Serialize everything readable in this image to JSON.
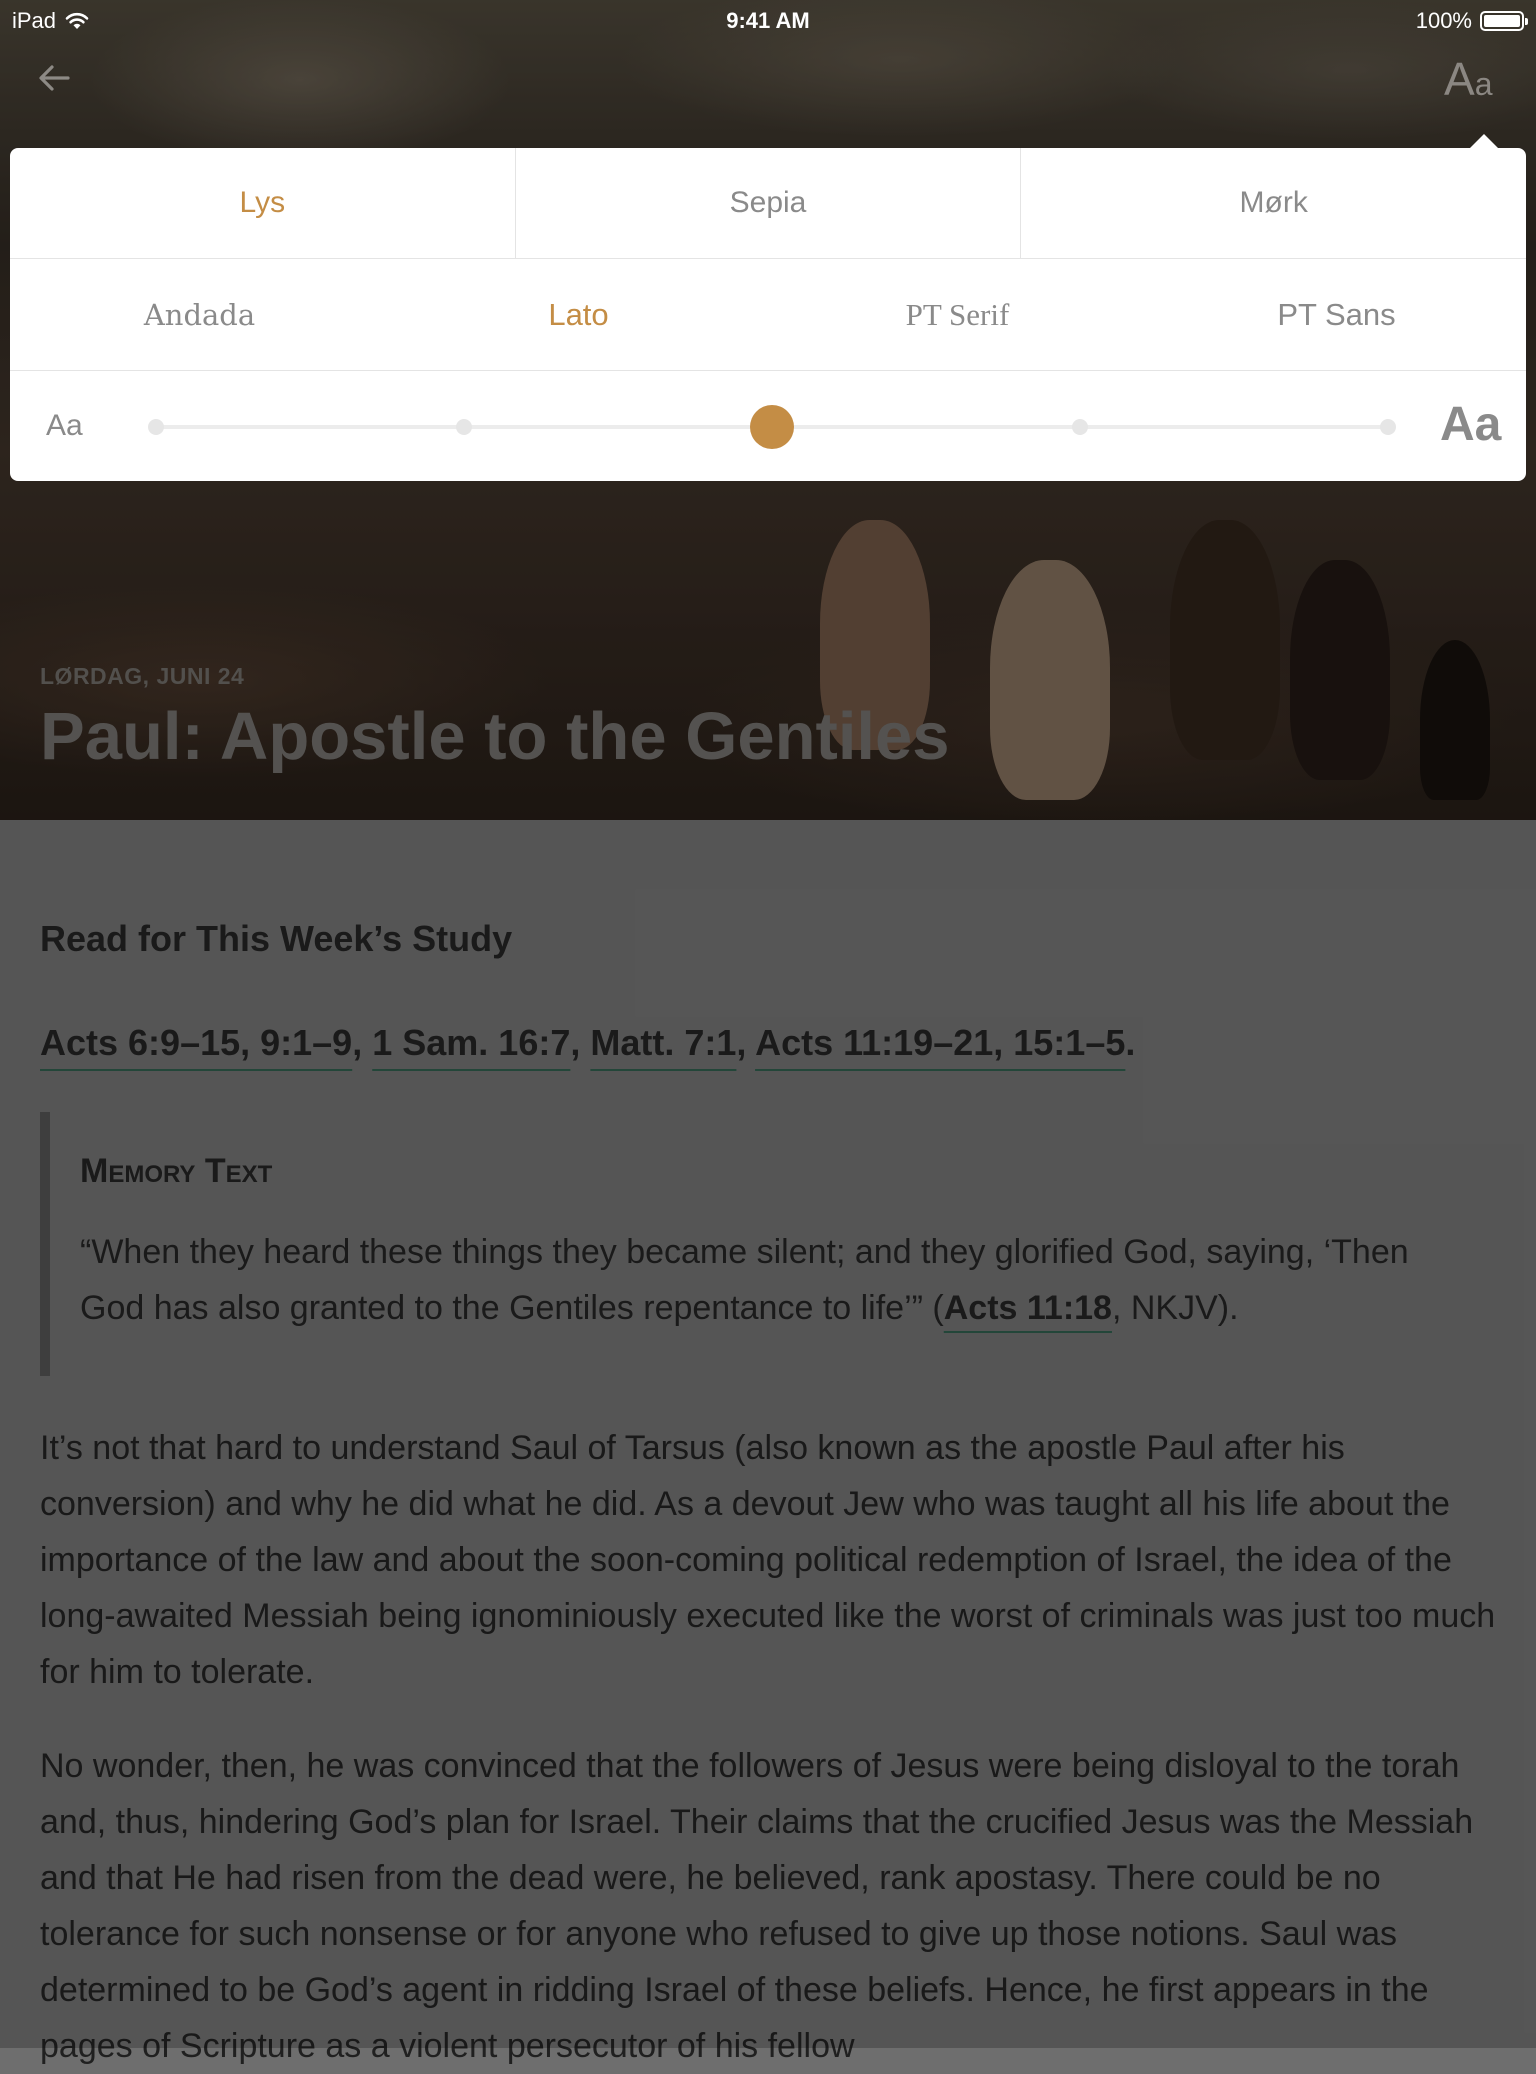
{
  "status_bar": {
    "carrier": "iPad",
    "time": "9:41 AM",
    "battery": "100%"
  },
  "nav": {
    "font_button_big": "A",
    "font_button_small": "a"
  },
  "settings": {
    "themes": [
      {
        "label": "Lys",
        "active": true
      },
      {
        "label": "Sepia",
        "active": false
      },
      {
        "label": "Mørk",
        "active": false
      }
    ],
    "fonts": [
      {
        "label": "Andada",
        "active": false
      },
      {
        "label": "Lato",
        "active": true
      },
      {
        "label": "PT Serif",
        "active": false
      },
      {
        "label": "PT Sans",
        "active": false
      }
    ],
    "size_small_label": "Aa",
    "size_large_label": "Aa",
    "size_steps": 5,
    "size_selected_step": 3,
    "accent_color": "#c48d45"
  },
  "lesson": {
    "date": "LØRDAG, JUNI 24",
    "title": "Paul: Apostle to the Gentiles"
  },
  "content": {
    "read_heading": "Read for This Week’s Study",
    "refs": [
      "Acts 6:9–15, 9:1–9",
      "1 Sam. 16:7",
      "Matt. 7:1",
      "Acts 11:19–21, 15:1–5"
    ],
    "ref_sep": ", ",
    "ref_end": ".",
    "memory_title": "Memory Text",
    "memory_text_before": "“When they heard these things they became silent; and they glorified God, saying, ‘Then God has also granted to the Gentiles repentance to life’” (",
    "memory_ref": "Acts 11:18",
    "memory_text_after": ", NKJV).",
    "paragraph1": "It’s not that hard to understand Saul of Tarsus (also known as the apostle Paul after his conversion) and why he did what he did. As a devout Jew who was taught all his life about the importance of the law and about the soon-coming political redemption of Israel, the idea of the long-awaited Messiah being ignominiously executed like the worst of criminals was just too much for him to tolerate.",
    "paragraph2": "No wonder, then, he was convinced that the followers of Jesus were being disloyal to the torah and, thus, hindering God’s plan for Israel. Their claims that the crucified Jesus was the Messiah and that He had risen from the dead were, he believed, rank apostasy. There could be no tolerance for such nonsense or for anyone who refused to give up those notions. Saul was determined to be God’s agent in ridding Israel of these beliefs. Hence, he first appears in the pages of Scripture as a violent persecutor of his fellow"
  }
}
